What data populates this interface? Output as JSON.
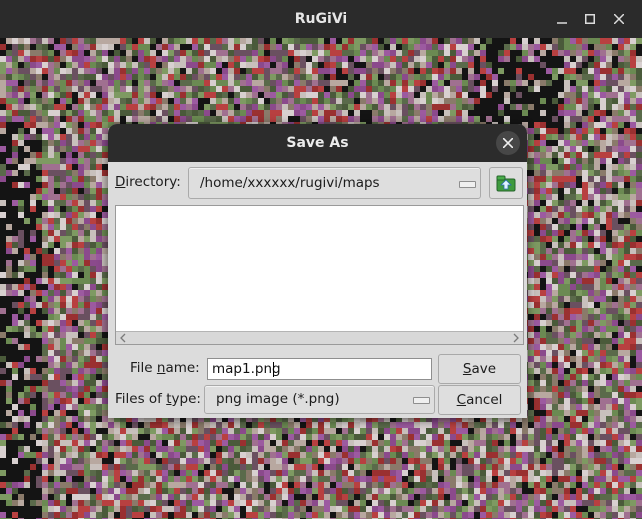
{
  "window": {
    "title": "RuGiVi",
    "minimize_icon": "minimize-icon",
    "maximize_icon": "maximize-icon",
    "close_icon": "close-icon"
  },
  "dialog": {
    "title": "Save As",
    "directory": {
      "label_underlined": "D",
      "label_rest": "irectory:",
      "value": "/home/xxxxxx/rugivi/maps"
    },
    "up_folder_icon": "folder-up-icon",
    "file_name": {
      "label_pre": "File ",
      "label_underlined": "n",
      "label_post": "ame:",
      "value": "map1.png"
    },
    "file_type": {
      "label_pre": "Files of ",
      "label_underlined": "t",
      "label_post": "ype:",
      "value": "png image (*.png)"
    },
    "save_button": {
      "underlined": "S",
      "rest": "ave"
    },
    "cancel_button": {
      "underlined": "C",
      "rest": "ancel"
    }
  },
  "colors": {
    "titlebar": "#2b2b2b",
    "dialog_bg": "#dcdcdc",
    "canvas_bg": "#141414",
    "folder_green": "#3a9a3a"
  }
}
